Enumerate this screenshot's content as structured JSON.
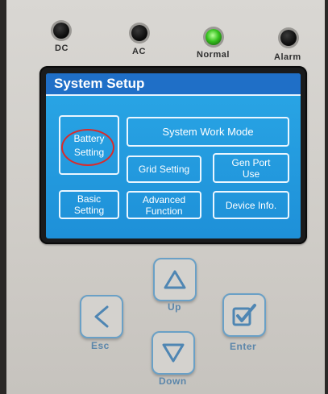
{
  "indicators": [
    {
      "label": "DC",
      "state": "off"
    },
    {
      "label": "AC",
      "state": "off"
    },
    {
      "label": "Normal",
      "state": "on",
      "color": "#36c21e"
    },
    {
      "label": "Alarm",
      "state": "off"
    }
  ],
  "screen": {
    "title": "System Setup",
    "buttons": {
      "battery_setting_line1": "Battery",
      "battery_setting_line2": "Setting",
      "system_work_mode": "System Work Mode",
      "grid_setting": "Grid Setting",
      "gen_port_use_line1": "Gen Port",
      "gen_port_use_line2": "Use",
      "basic_setting_line1": "Basic",
      "basic_setting_line2": "Setting",
      "advanced_function_line1": "Advanced",
      "advanced_function_line2": "Function",
      "device_info": "Device Info."
    },
    "highlight_color": "#d92b2b"
  },
  "keys": {
    "up": "Up",
    "esc": "Esc",
    "enter": "Enter",
    "down": "Down"
  }
}
